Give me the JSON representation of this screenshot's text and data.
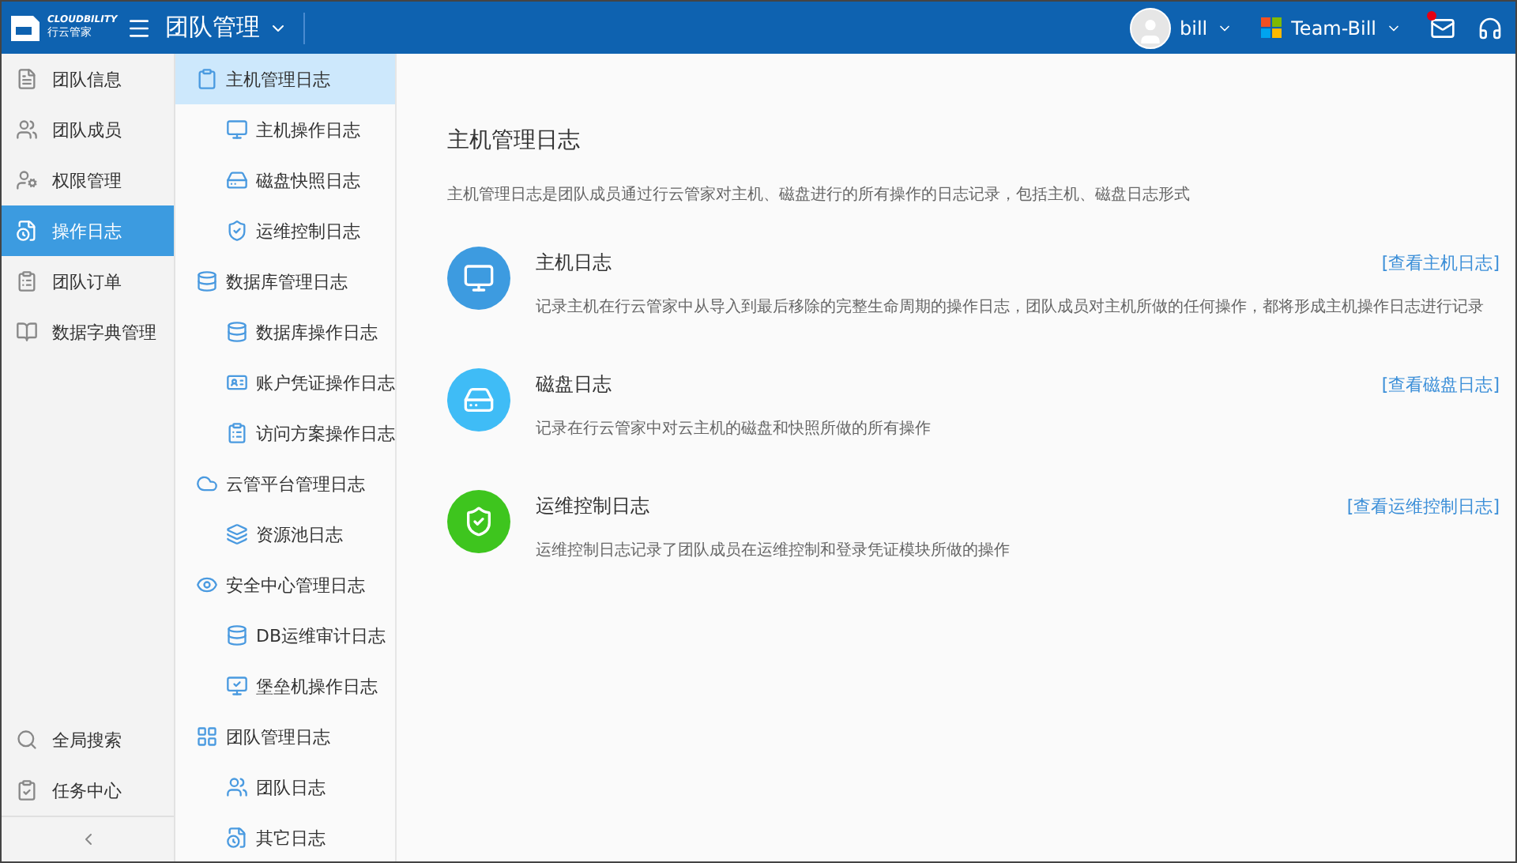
{
  "header": {
    "logo": {
      "brand": "CLOUDBILITY",
      "subtitle": "行云管家"
    },
    "title": "团队管理",
    "user": {
      "name": "bill"
    },
    "team": {
      "name": "Team-Bill"
    },
    "messages": {
      "unread": true
    }
  },
  "sidebar": {
    "items": [
      {
        "label": "团队信息",
        "selected": false
      },
      {
        "label": "团队成员",
        "selected": false
      },
      {
        "label": "权限管理",
        "selected": false
      },
      {
        "label": "操作日志",
        "selected": true
      },
      {
        "label": "团队订单",
        "selected": false
      },
      {
        "label": "数据字典管理",
        "selected": false
      }
    ],
    "bottom_items": [
      {
        "label": "全局搜索"
      },
      {
        "label": "任务中心"
      }
    ]
  },
  "subnav": {
    "groups": [
      {
        "label": "主机管理日志",
        "selected": true,
        "children": [
          {
            "label": "主机操作日志",
            "selected": false
          },
          {
            "label": "磁盘快照日志",
            "selected": false
          },
          {
            "label": "运维控制日志",
            "selected": false
          }
        ]
      },
      {
        "label": "数据库管理日志",
        "selected": false,
        "children": [
          {
            "label": "数据库操作日志",
            "selected": false
          },
          {
            "label": "账户凭证操作日志",
            "selected": false
          },
          {
            "label": "访问方案操作日志",
            "selected": false
          }
        ]
      },
      {
        "label": "云管平台管理日志",
        "selected": false,
        "children": [
          {
            "label": "资源池日志",
            "selected": false
          }
        ]
      },
      {
        "label": "安全中心管理日志",
        "selected": false,
        "children": [
          {
            "label": "DB运维审计日志",
            "selected": false
          },
          {
            "label": "堡垒机操作日志",
            "selected": false
          }
        ]
      },
      {
        "label": "团队管理日志",
        "selected": false,
        "children": [
          {
            "label": "团队日志",
            "selected": false
          },
          {
            "label": "其它日志",
            "selected": false
          }
        ]
      }
    ]
  },
  "main": {
    "title": "主机管理日志",
    "description": "主机管理日志是团队成员通过行云管家对主机、磁盘进行的所有操作的日志记录，包括主机、磁盘日志形式",
    "sections": [
      {
        "kind": "host",
        "title": "主机日志",
        "description": "记录主机在行云管家中从导入到最后移除的完整生命周期的操作日志，团队成员对主机所做的任何操作，都将形成主机操作日志进行记录",
        "link": "[查看主机日志]",
        "color": "#3d9be0"
      },
      {
        "kind": "disk",
        "title": "磁盘日志",
        "description": "记录在行云管家中对云主机的磁盘和快照所做的所有操作",
        "link": "[查看磁盘日志]",
        "color": "#3fbcf6"
      },
      {
        "kind": "ops",
        "title": "运维控制日志",
        "description": "运维控制日志记录了团队成员在运维控制和登录凭证模块所做的操作",
        "link": "[查看运维控制日志]",
        "color": "#3ec51e"
      }
    ]
  }
}
